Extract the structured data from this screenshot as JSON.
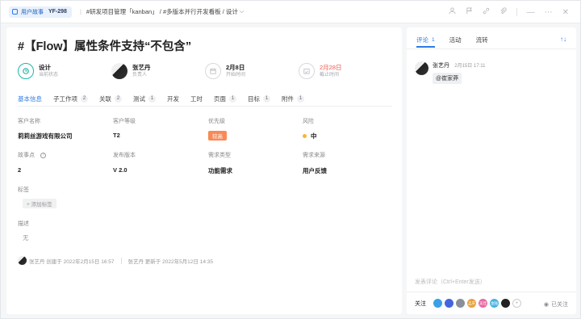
{
  "topbar": {
    "type_label": "用户故事",
    "issue_id": "YF-298",
    "breadcrumb": [
      "#研发项目管理「kanban」",
      "/ #多版本并行开发看板",
      "/ 设计"
    ],
    "icons": [
      "assign-icon",
      "flag-icon",
      "link-icon",
      "attachment-icon",
      "minimize-icon",
      "more-icon",
      "close-icon"
    ]
  },
  "issue": {
    "title": "#【Flow】属性条件支持“不包含”",
    "status": {
      "value": "设计",
      "label": "当前状态"
    },
    "assignee": {
      "value": "张艺丹",
      "label": "负责人"
    },
    "start": {
      "value": "2月8日",
      "label": "开始时间"
    },
    "end": {
      "value": "2月28日",
      "label": "截止时间"
    },
    "colors": {
      "accent": "#2c7be5",
      "overdue": "#f0564a",
      "status": "#21b6a8",
      "priority": "#f88a57",
      "risk": "#f7b731"
    }
  },
  "tabs": [
    {
      "label": "基本信息",
      "count": ""
    },
    {
      "label": "子工作项",
      "count": "2"
    },
    {
      "label": "关联",
      "count": "2"
    },
    {
      "label": "测试",
      "count": "1"
    },
    {
      "label": "开发",
      "count": ""
    },
    {
      "label": "工时",
      "count": ""
    },
    {
      "label": "页面",
      "count": "1"
    },
    {
      "label": "目标",
      "count": "1"
    },
    {
      "label": "附件",
      "count": "1"
    }
  ],
  "fields": {
    "customer_name": {
      "label": "客户名称",
      "value": "莉莉丝游戏有限公司"
    },
    "customer_level": {
      "label": "客户等级",
      "value": "T2"
    },
    "priority": {
      "label": "优先级",
      "value": "较高"
    },
    "risk": {
      "label": "风险",
      "value": "中"
    },
    "story_points": {
      "label": "故事点",
      "value": "2"
    },
    "release": {
      "label": "发布版本",
      "value": "V 2.0"
    },
    "req_type": {
      "label": "需求类型",
      "value": "功能需求"
    },
    "req_source": {
      "label": "需求来源",
      "value": "用户反馈"
    },
    "tags": {
      "label": "标签",
      "add": "+ 添加标签"
    },
    "description": {
      "label": "描述",
      "value": "无"
    }
  },
  "footer": {
    "created": "张艺丹 创建于 2022年2月15日 16:57",
    "updated": "张艺丹 更新于 2022年5月12日 14:35"
  },
  "side": {
    "tabs": [
      {
        "label": "评论",
        "count": "1"
      },
      {
        "label": "活动",
        "count": ""
      },
      {
        "label": "流转",
        "count": ""
      }
    ],
    "sort_icon": "↑↓",
    "comment": {
      "author": "张艺丹",
      "time": "2月15日 17:11",
      "text": "@崔家莽"
    },
    "input_placeholder": "发表评论（Ctrl+Enter发送）",
    "follow_label": "关注",
    "watched_label": "已关注",
    "followers": [
      {
        "color": "#3aa0e8",
        "label": ""
      },
      {
        "color": "#4466dd",
        "label": ""
      },
      {
        "color": "#8a8f99",
        "label": ""
      },
      {
        "color": "#e9a23b",
        "label": "孟庆"
      },
      {
        "color": "#e86ba3",
        "label": "吴佳"
      },
      {
        "color": "#4ab3e0",
        "label": "金陆"
      },
      {
        "color": "#222222",
        "label": ""
      }
    ]
  }
}
